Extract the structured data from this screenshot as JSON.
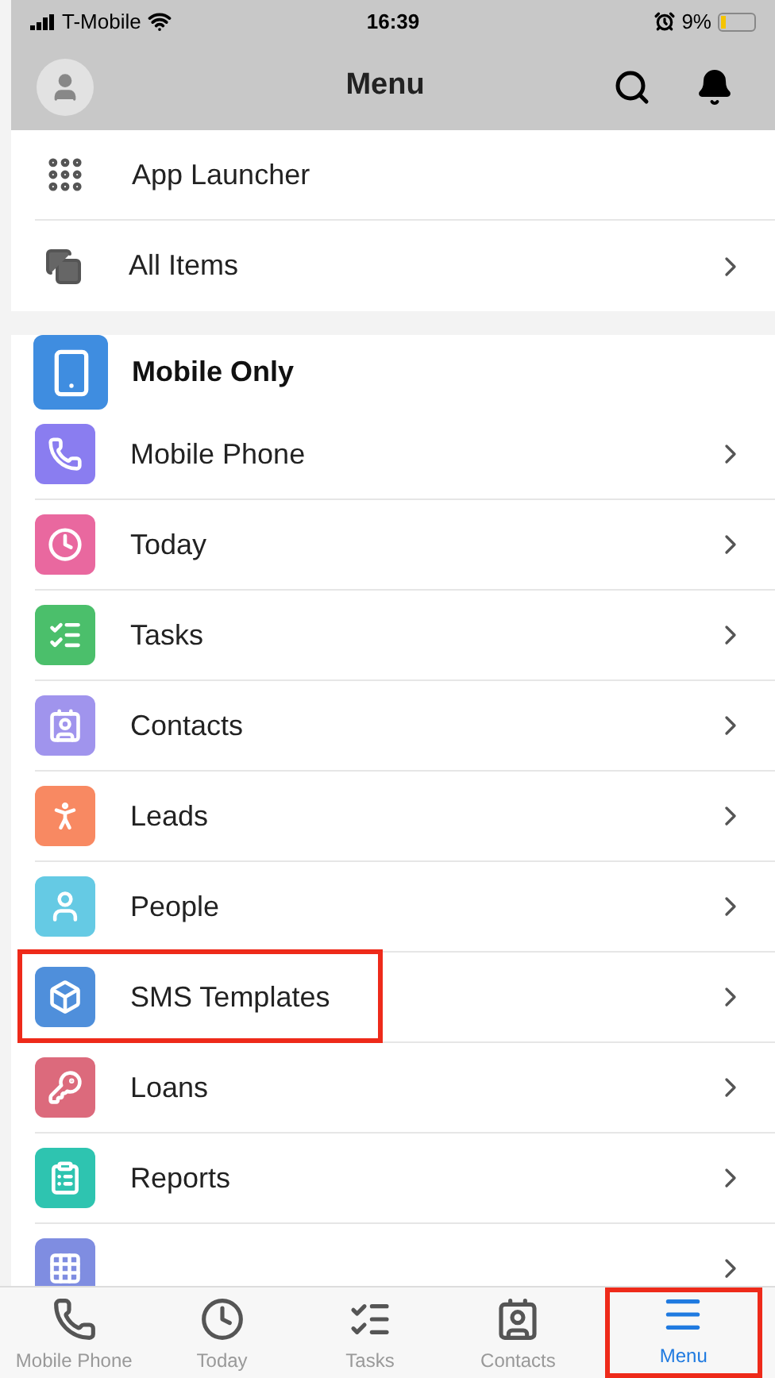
{
  "status_bar": {
    "carrier": "T-Mobile",
    "time": "16:39",
    "battery": "9%"
  },
  "header": {
    "title": "Menu"
  },
  "top_items": [
    {
      "kind": "launcher",
      "label": "App Launcher",
      "chevron": false
    },
    {
      "kind": "items",
      "label": "All Items",
      "chevron": true
    }
  ],
  "section": {
    "title": "Mobile Only"
  },
  "menu_items": [
    {
      "kind": "phone",
      "label": "Mobile Phone",
      "color": "#8a7df0",
      "highlighted": false
    },
    {
      "kind": "clock",
      "label": "Today",
      "color": "#e9689f",
      "highlighted": false
    },
    {
      "kind": "tasks",
      "label": "Tasks",
      "color": "#4bbf6b",
      "highlighted": false
    },
    {
      "kind": "contact",
      "label": "Contacts",
      "color": "#a094ed",
      "highlighted": false
    },
    {
      "kind": "lead",
      "label": "Leads",
      "color": "#f88962",
      "highlighted": false
    },
    {
      "kind": "person",
      "label": "People",
      "color": "#65cae4",
      "highlighted": false
    },
    {
      "kind": "cube",
      "label": "SMS Templates",
      "color": "#4f8fdb",
      "highlighted": true
    },
    {
      "kind": "key",
      "label": "Loans",
      "color": "#dc6a7c",
      "highlighted": false
    },
    {
      "kind": "report",
      "label": "Reports",
      "color": "#2ec4b0",
      "highlighted": false
    },
    {
      "kind": "grid",
      "color": "#7f8de1",
      "highlighted": false
    }
  ],
  "tab_bar": [
    {
      "kind": "phone",
      "label": "Mobile Phone",
      "selected": false,
      "highlighted": false
    },
    {
      "kind": "clock",
      "label": "Today",
      "selected": false,
      "highlighted": false
    },
    {
      "kind": "tasks",
      "label": "Tasks",
      "selected": false,
      "highlighted": false
    },
    {
      "kind": "contact",
      "label": "Contacts",
      "selected": false,
      "highlighted": false
    },
    {
      "kind": "menu",
      "label": "Menu",
      "selected": true,
      "highlighted": true
    }
  ]
}
